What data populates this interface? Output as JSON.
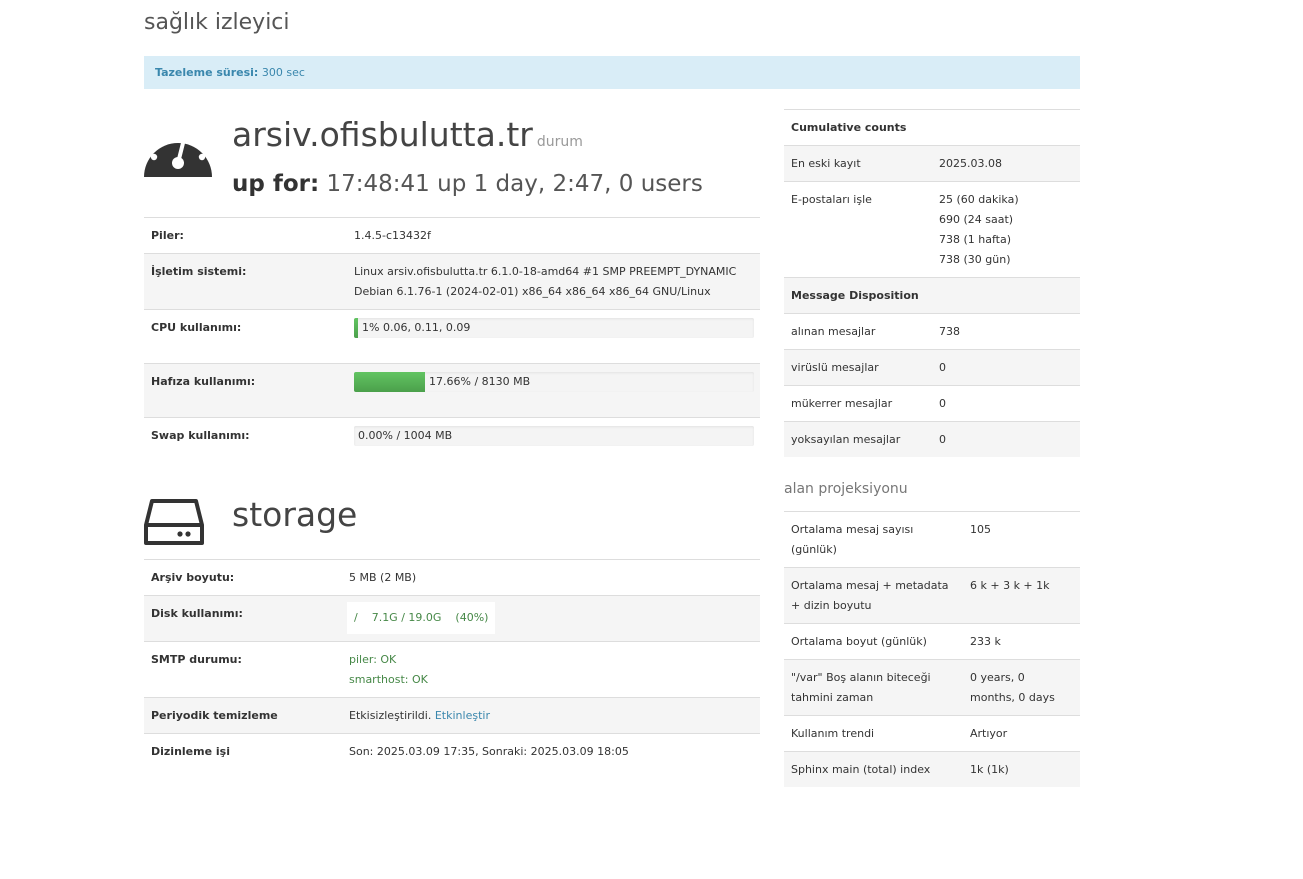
{
  "page": {
    "title": "sağlık izleyici"
  },
  "refresh": {
    "label": "Tazeleme süresi:",
    "value": "300 sec"
  },
  "status": {
    "hostname": "arsiv.ofisbulutta.tr",
    "suffix": "durum",
    "uptime_label": "up for:",
    "uptime_value": "17:48:41 up 1 day, 2:47, 0 users",
    "rows": {
      "piler_label": "Piler:",
      "piler_value": "1.4.5-c13432f",
      "os_label": "İşletim sistemi:",
      "os_line1": "Linux arsiv.ofisbulutta.tr 6.1.0-18-amd64 #1 SMP PREEMPT_DYNAMIC",
      "os_line2": "Debian 6.1.76-1 (2024-02-01) x86_64 x86_64 x86_64 GNU/Linux",
      "cpu_label": "CPU kullanımı:",
      "cpu_text": "1% 0.06, 0.11, 0.09",
      "cpu_percent": 1,
      "mem_label": "Hafıza kullanımı:",
      "mem_text": "17.66% / 8130 MB",
      "mem_percent": 17.66,
      "swap_label": "Swap kullanımı:",
      "swap_text": "0.00% / 1004 MB",
      "swap_percent": 0
    }
  },
  "storage": {
    "title": "storage",
    "archive_label": "Arşiv boyutu:",
    "archive_value": "5 MB (2 MB)",
    "disk_label": "Disk kullanımı:",
    "disk_value": "/    7.1G / 19.0G    (40%)",
    "smtp_label": "SMTP durumu:",
    "smtp_line1": "piler: OK",
    "smtp_line2": "smarthost: OK",
    "purge_label": "Periyodik temizleme",
    "purge_value": "Etkisizleştirildi.",
    "purge_link": "Etkinleştir",
    "index_label": "Dizinleme işi",
    "index_value": "Son: 2025.03.09 17:35, Sonraki: 2025.03.09 18:05"
  },
  "counts": {
    "header": "Cumulative counts",
    "oldest_label": "En eski kayıt",
    "oldest_value": "2025.03.08",
    "processed_label": "E-postaları işle",
    "processed_values": [
      "25 (60 dakika)",
      "690 (24 saat)",
      "738 (1 hafta)",
      "738 (30 gün)"
    ],
    "disposition_header": "Message Disposition",
    "received_label": "alınan mesajlar",
    "received_value": "738",
    "virus_label": "virüslü mesajlar",
    "virus_value": "0",
    "dup_label": "mükerrer mesajlar",
    "dup_value": "0",
    "ignored_label": "yoksayılan mesajlar",
    "ignored_value": "0"
  },
  "projection": {
    "title": "alan projeksiyonu",
    "rows": [
      {
        "label": "Ortalama mesaj sayısı (günlük)",
        "value": "105"
      },
      {
        "label": "Ortalama mesaj + metadata + dizin boyutu",
        "value": "6 k + 3 k + 1k"
      },
      {
        "label": "Ortalama boyut (günlük)",
        "value": "233 k"
      },
      {
        "label": "\"/var\" Boş alanın biteceği tahmini zaman",
        "value": "0 years, 0 months, 0 days"
      },
      {
        "label": "Kullanım trendi",
        "value": "Artıyor"
      },
      {
        "label": "Sphinx main (total) index",
        "value": "1k (1k)"
      }
    ]
  }
}
